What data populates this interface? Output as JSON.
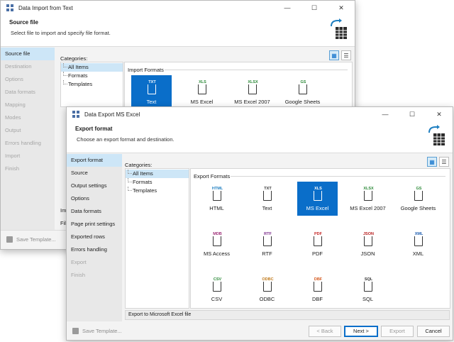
{
  "back_window": {
    "title": "Data Import from Text",
    "header_title": "Source file",
    "header_desc": "Select file to import and specify file format.",
    "nav": [
      {
        "label": "Source file",
        "state": "selected"
      },
      {
        "label": "Destination",
        "state": "disabled"
      },
      {
        "label": "Options",
        "state": "disabled"
      },
      {
        "label": "Data formats",
        "state": "disabled"
      },
      {
        "label": "Mapping",
        "state": "disabled"
      },
      {
        "label": "Modes",
        "state": "disabled"
      },
      {
        "label": "Output",
        "state": "disabled"
      },
      {
        "label": "Errors handling",
        "state": "disabled"
      },
      {
        "label": "Import",
        "state": "disabled"
      },
      {
        "label": "Finish",
        "state": "disabled"
      }
    ],
    "categories_label": "Categories:",
    "categories": [
      "All Items",
      "Formats",
      "Templates"
    ],
    "formats_title": "Import Formats",
    "formats": [
      {
        "tag": "TXT",
        "name": "Text",
        "tag_color": "#ffffff"
      },
      {
        "tag": "XLS",
        "name": "MS Excel",
        "tag_color": "#2e8b3a"
      },
      {
        "tag": "XLSX",
        "name": "MS Excel 2007",
        "tag_color": "#2e8b3a"
      },
      {
        "tag": "GS",
        "name": "Google Sheets",
        "tag_color": "#2e8b3a"
      }
    ],
    "peek_a": "Imp",
    "peek_b": "File",
    "save_template": "Save Template..."
  },
  "front_window": {
    "title": "Data Export MS Excel",
    "header_title": "Export format",
    "header_desc": "Choose an export format and destination.",
    "nav": [
      {
        "label": "Export format",
        "state": "selected"
      },
      {
        "label": "Source",
        "state": "normal"
      },
      {
        "label": "Output settings",
        "state": "normal"
      },
      {
        "label": "Options",
        "state": "normal"
      },
      {
        "label": "Data formats",
        "state": "normal"
      },
      {
        "label": "Page print settings",
        "state": "normal"
      },
      {
        "label": "Exported rows",
        "state": "normal"
      },
      {
        "label": "Errors handling",
        "state": "normal"
      },
      {
        "label": "Export",
        "state": "disabled"
      },
      {
        "label": "Finish",
        "state": "disabled"
      }
    ],
    "categories_label": "Categories:",
    "categories": [
      "All Items",
      "Formats",
      "Templates"
    ],
    "formats_title": "Export Formats",
    "formats": [
      {
        "tag": "HTML",
        "name": "HTML",
        "tag_color": "#1f7fc1"
      },
      {
        "tag": "TXT",
        "name": "Text",
        "tag_color": "#333333"
      },
      {
        "tag": "XLS",
        "name": "MS Excel",
        "tag_color": "#ffffff"
      },
      {
        "tag": "XLSX",
        "name": "MS Excel 2007",
        "tag_color": "#2e8b3a"
      },
      {
        "tag": "GS",
        "name": "Google Sheets",
        "tag_color": "#2e8b3a"
      },
      {
        "tag": "MDB",
        "name": "MS Access",
        "tag_color": "#a0307a"
      },
      {
        "tag": "RTF",
        "name": "RTF",
        "tag_color": "#7a2a8a"
      },
      {
        "tag": "PDF",
        "name": "PDF",
        "tag_color": "#c62828"
      },
      {
        "tag": "JSON",
        "name": "JSON",
        "tag_color": "#b71c1c"
      },
      {
        "tag": "XML",
        "name": "XML",
        "tag_color": "#1f5fb0"
      },
      {
        "tag": "CSV",
        "name": "CSV",
        "tag_color": "#2e8b3a"
      },
      {
        "tag": "ODBC",
        "name": "ODBC",
        "tag_color": "#c07a1a"
      },
      {
        "tag": "DBF",
        "name": "DBF",
        "tag_color": "#d4571b"
      },
      {
        "tag": "SQL",
        "name": "SQL",
        "tag_color": "#333333"
      }
    ],
    "status": "Export to Microsoft Excel file",
    "save_template": "Save Template...",
    "back_button": "< Back",
    "next_button": "Next >",
    "export_button": "Export",
    "cancel_button": "Cancel"
  },
  "selected_export_format": "MS Excel",
  "colors": {
    "accent": "#0a6ec9",
    "selection": "#cde6f7"
  }
}
